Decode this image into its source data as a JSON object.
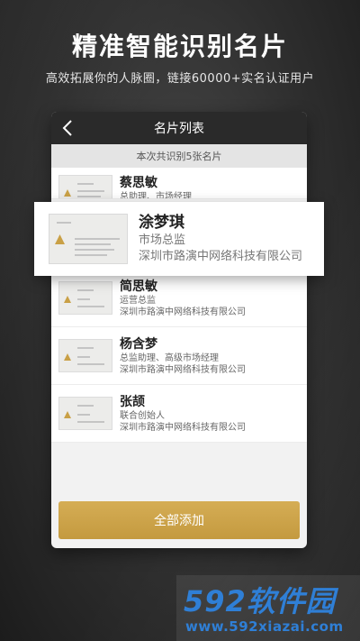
{
  "header": {
    "headline": "精准智能识别名片",
    "subline": "高效拓展你的人脉圈，链接60000+实名认证用户"
  },
  "screen": {
    "title": "名片列表",
    "count_text": "本次共识别5张名片",
    "add_all_label": "全部添加"
  },
  "cards": [
    {
      "name": "蔡思敏",
      "role": "总助理、市场经理",
      "company": ""
    },
    {
      "name": "涂梦琪",
      "role": "市场总监",
      "company": "深圳市路演中网络科技有限公司"
    },
    {
      "name": "简思敏",
      "role": "运营总监",
      "company": "深圳市路演中网络科技有限公司"
    },
    {
      "name": "杨含梦",
      "role": "总监助理、高级市场经理",
      "company": "深圳市路演中网络科技有限公司"
    },
    {
      "name": "张颉",
      "role": "联合创始人",
      "company": "深圳市路演中网络科技有限公司"
    }
  ],
  "watermark": {
    "brand": "592软件园",
    "url": "www.592xiazai.com"
  },
  "colors": {
    "accent_gold": "#c9a046",
    "titlebar": "#2a2a2a",
    "watermark_blue": "#2f7fd6"
  }
}
